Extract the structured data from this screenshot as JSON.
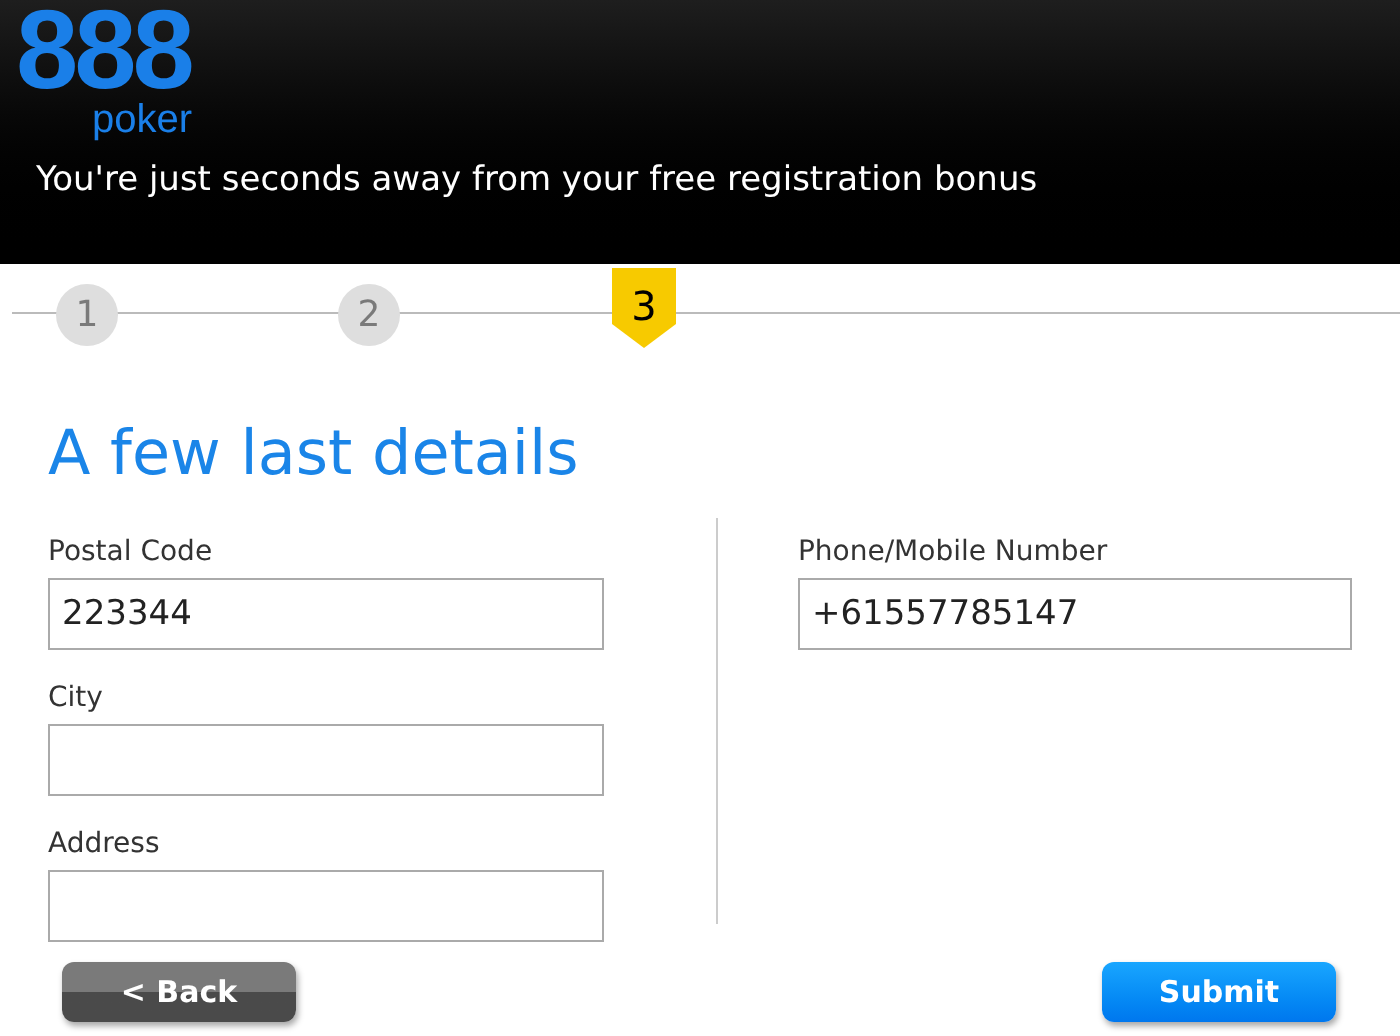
{
  "logo": {
    "digits": "888",
    "word": "poker"
  },
  "tagline": "You're just seconds away from your free registration bonus",
  "steps": [
    {
      "label": "1",
      "selected": false
    },
    {
      "label": "2",
      "selected": false
    },
    {
      "label": "3",
      "selected": true
    }
  ],
  "heading": "A few last details",
  "left_fields": [
    {
      "label": "Postal Code",
      "value": "223344"
    },
    {
      "label": "City"
    },
    {
      "label": "Address"
    }
  ],
  "right_fields": [
    {
      "label": "Phone/Mobile Number",
      "value": "+61557785147"
    }
  ],
  "buttons": [
    {
      "label": "< Back",
      "kind": "back"
    },
    {
      "label": "Submit",
      "kind": "submit"
    }
  ]
}
